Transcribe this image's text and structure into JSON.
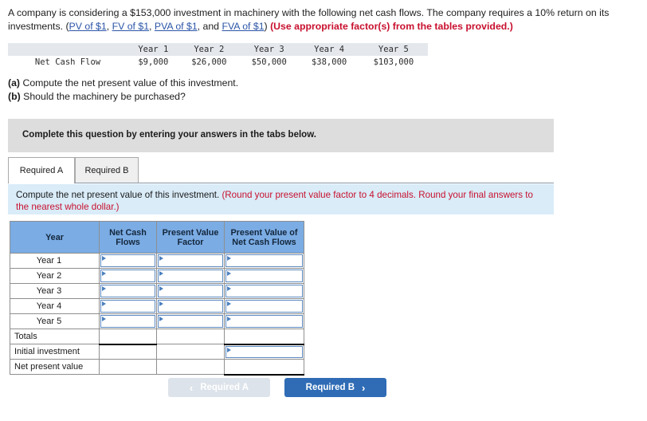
{
  "problem": {
    "line1_a": "A company is considering a $153,000 investment in machinery with the following net cash flows. The company requires a 10% return",
    "line2_a": "on its investments. (",
    "links": [
      "PV of $1",
      "FV of $1",
      "PVA of $1",
      "FVA of $1"
    ],
    "sep1": ", ",
    "sep2": ", ",
    "sep3": ", and ",
    "close_paren": ") ",
    "emphasis": "(Use appropriate factor(s) from the tables provided.)"
  },
  "cash_flow_table": {
    "corner": "",
    "columns": [
      "Year 1",
      "Year 2",
      "Year 3",
      "Year 4",
      "Year 5"
    ],
    "row_label": "Net Cash Flow",
    "values": [
      "$9,000",
      "$26,000",
      "$50,000",
      "$38,000",
      "$103,000"
    ]
  },
  "questions": {
    "a_marker": "(a)",
    "a_text": " Compute the net present value of this investment.",
    "b_marker": "(b)",
    "b_text": " Should the machinery be purchased?"
  },
  "gray_band": {
    "text": "Complete this question by entering your answers in the tabs below."
  },
  "tabs": [
    {
      "label": "Required A",
      "active": true
    },
    {
      "label": "Required B",
      "active": false
    }
  ],
  "blue_panel": {
    "black_text": "Compute the net present value of this investment. ",
    "red_text": "(Round your present value factor to 4 decimals. Round your final answers to the nearest whole dollar.)"
  },
  "answer_grid": {
    "headers": [
      "Year",
      "Net Cash Flows",
      "Present Value Factor",
      "Present Value of Net Cash Flows"
    ],
    "year_rows": [
      "Year 1",
      "Year 2",
      "Year 3",
      "Year 4",
      "Year 5"
    ],
    "summary_rows": [
      "Totals",
      "Initial investment",
      "Net present value"
    ],
    "values": {
      "net_cash_flows": [
        "",
        "",
        "",
        "",
        ""
      ],
      "present_value_factor": [
        "",
        "",
        "",
        "",
        ""
      ],
      "present_value_of_net_cash_flows": [
        "",
        "",
        "",
        "",
        ""
      ],
      "totals_net_cash_flows": "",
      "totals_present_value_factor": "",
      "totals_present_value": "",
      "initial_investment": "",
      "net_present_value": ""
    }
  },
  "footer_nav": {
    "prev_chevron": "‹",
    "prev_label": "Required A",
    "next_label": "Required B",
    "next_chevron": "›"
  },
  "colors": {
    "link": "#2b55a8",
    "red_emphasis": "#c8102e",
    "header_blue": "#7bace4",
    "panel_blue": "#d9ecf8",
    "band_gray": "#dddddd",
    "button_blue": "#2f6cb5",
    "button_disabled": "#dde3ea",
    "input_border": "#5b89c0"
  }
}
